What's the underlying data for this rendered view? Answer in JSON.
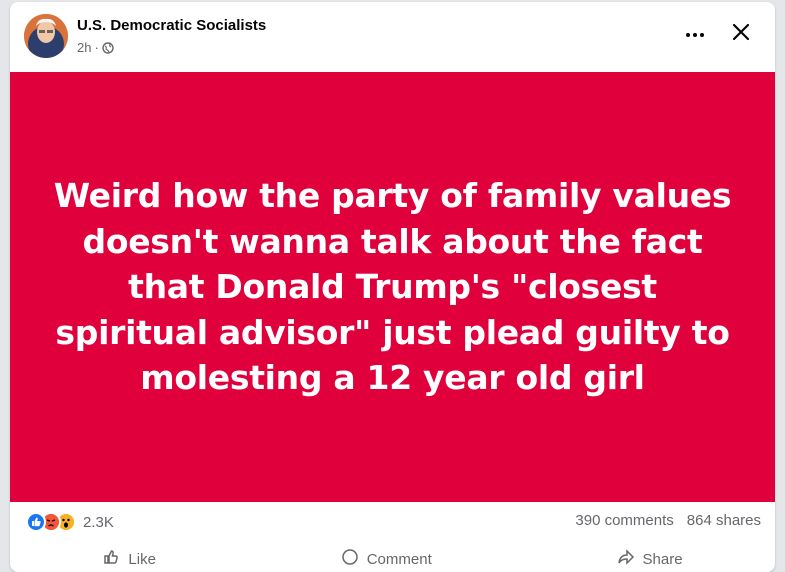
{
  "post": {
    "page_name": "U.S. Democratic Socialists",
    "time": "2h",
    "separator": "·",
    "text": "Weird how the party of family values doesn't wanna talk about the fact that Donald Trump's \"closest spiritual advisor\" just plead guilty to molesting a 12 year old girl",
    "image_bg": "#e0003c"
  },
  "stats": {
    "reaction_count": "2.3K",
    "comments": "390 comments",
    "shares": "864 shares",
    "reactions": [
      "like",
      "angry",
      "wow"
    ]
  },
  "actions": {
    "like": "Like",
    "comment": "Comment",
    "share": "Share"
  },
  "colors": {
    "accent_red": "#e0003c",
    "like_blue": "#1877f2",
    "muted": "#65676b"
  }
}
